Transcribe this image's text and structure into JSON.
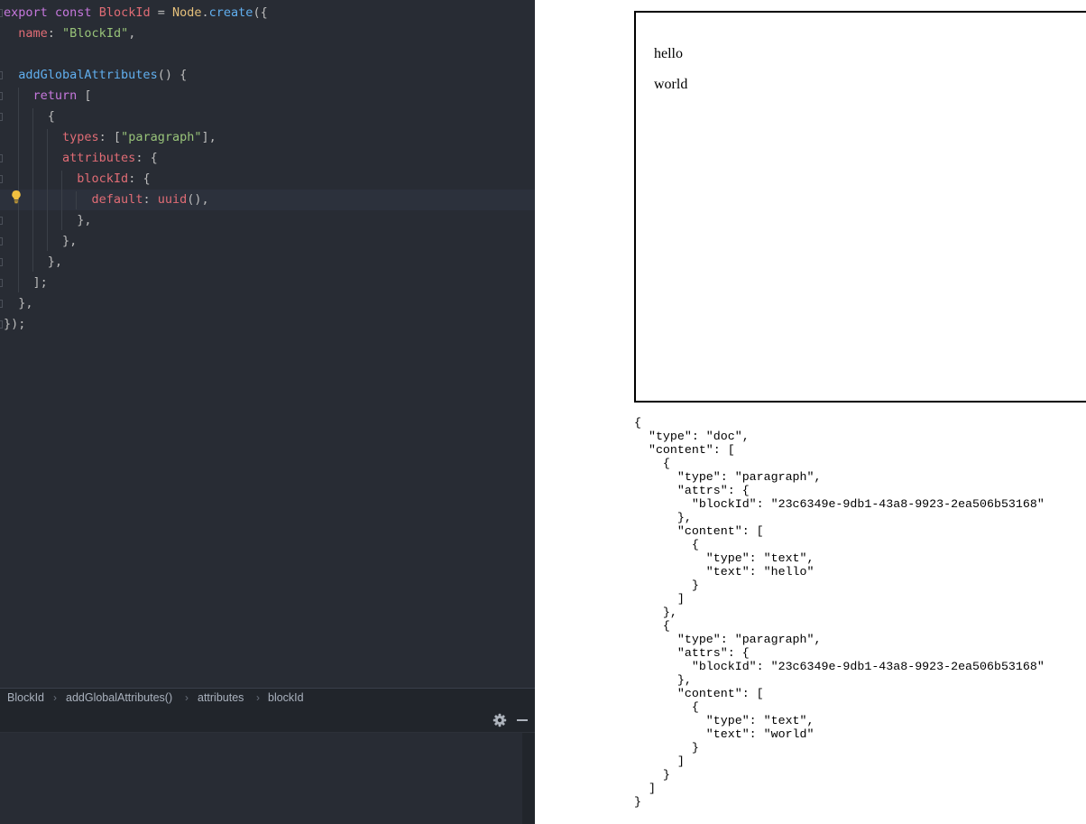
{
  "ide": {
    "editor": {
      "lines": [
        [
          [
            "export",
            "kw"
          ],
          [
            " ",
            "pn"
          ],
          [
            "const",
            "kw"
          ],
          [
            " ",
            "pn"
          ],
          [
            "BlockId",
            "cls"
          ],
          [
            " = ",
            "pn"
          ],
          [
            "Node",
            "type"
          ],
          [
            ".",
            "pn"
          ],
          [
            "create",
            "fn"
          ],
          [
            "({",
            "pn"
          ]
        ],
        [
          [
            "  ",
            "pn"
          ],
          [
            "name",
            "prop"
          ],
          [
            ": ",
            "pn"
          ],
          [
            "\"BlockId\"",
            "str"
          ],
          [
            ",",
            "pn"
          ]
        ],
        [
          [
            "",
            "pn"
          ]
        ],
        [
          [
            "  ",
            "pn"
          ],
          [
            "addGlobalAttributes",
            "fn"
          ],
          [
            "() {",
            "pn"
          ]
        ],
        [
          [
            "    ",
            "pn"
          ],
          [
            "return",
            "kw"
          ],
          [
            " [",
            "pn"
          ]
        ],
        [
          [
            "      {",
            "pn"
          ]
        ],
        [
          [
            "        ",
            "pn"
          ],
          [
            "types",
            "prop"
          ],
          [
            ": [",
            "pn"
          ],
          [
            "\"paragraph\"",
            "str"
          ],
          [
            "],",
            "pn"
          ]
        ],
        [
          [
            "        ",
            "pn"
          ],
          [
            "attributes",
            "prop"
          ],
          [
            ": {",
            "pn"
          ]
        ],
        [
          [
            "          ",
            "pn"
          ],
          [
            "blockId",
            "prop"
          ],
          [
            ": {",
            "pn"
          ]
        ],
        [
          [
            "            ",
            "pn"
          ],
          [
            "default",
            "prop"
          ],
          [
            ": ",
            "pn"
          ],
          [
            "uuid",
            "cls"
          ],
          [
            "(),",
            "pn"
          ]
        ],
        [
          [
            "          },",
            "pn"
          ]
        ],
        [
          [
            "        },",
            "pn"
          ]
        ],
        [
          [
            "      },",
            "pn"
          ]
        ],
        [
          [
            "    ];",
            "pn"
          ]
        ],
        [
          [
            "  },",
            "pn"
          ]
        ],
        [
          [
            "});",
            "pn"
          ]
        ]
      ]
    },
    "breadcrumb": [
      "BlockId",
      "addGlobalAttributes()",
      "attributes",
      "blockId"
    ],
    "breadcrumb_separator": "›",
    "icons": {
      "intention_bulb": "lightbulb-icon",
      "settings": "gear-icon",
      "minimize": "minimize-icon"
    },
    "colors": {
      "background": "#282c34",
      "keyword": "#c678dd",
      "string": "#98c379",
      "function": "#61afef",
      "type": "#e5c07b",
      "property": "#e06c75"
    }
  },
  "browser": {
    "editor_content": [
      "hello",
      "world"
    ],
    "json_output": "{\n  \"type\": \"doc\",\n  \"content\": [\n    {\n      \"type\": \"paragraph\",\n      \"attrs\": {\n        \"blockId\": \"23c6349e-9db1-43a8-9923-2ea506b53168\"\n      },\n      \"content\": [\n        {\n          \"type\": \"text\",\n          \"text\": \"hello\"\n        }\n      ]\n    },\n    {\n      \"type\": \"paragraph\",\n      \"attrs\": {\n        \"blockId\": \"23c6349e-9db1-43a8-9923-2ea506b53168\"\n      },\n      \"content\": [\n        {\n          \"type\": \"text\",\n          \"text\": \"world\"\n        }\n      ]\n    }\n  ]\n}"
  }
}
